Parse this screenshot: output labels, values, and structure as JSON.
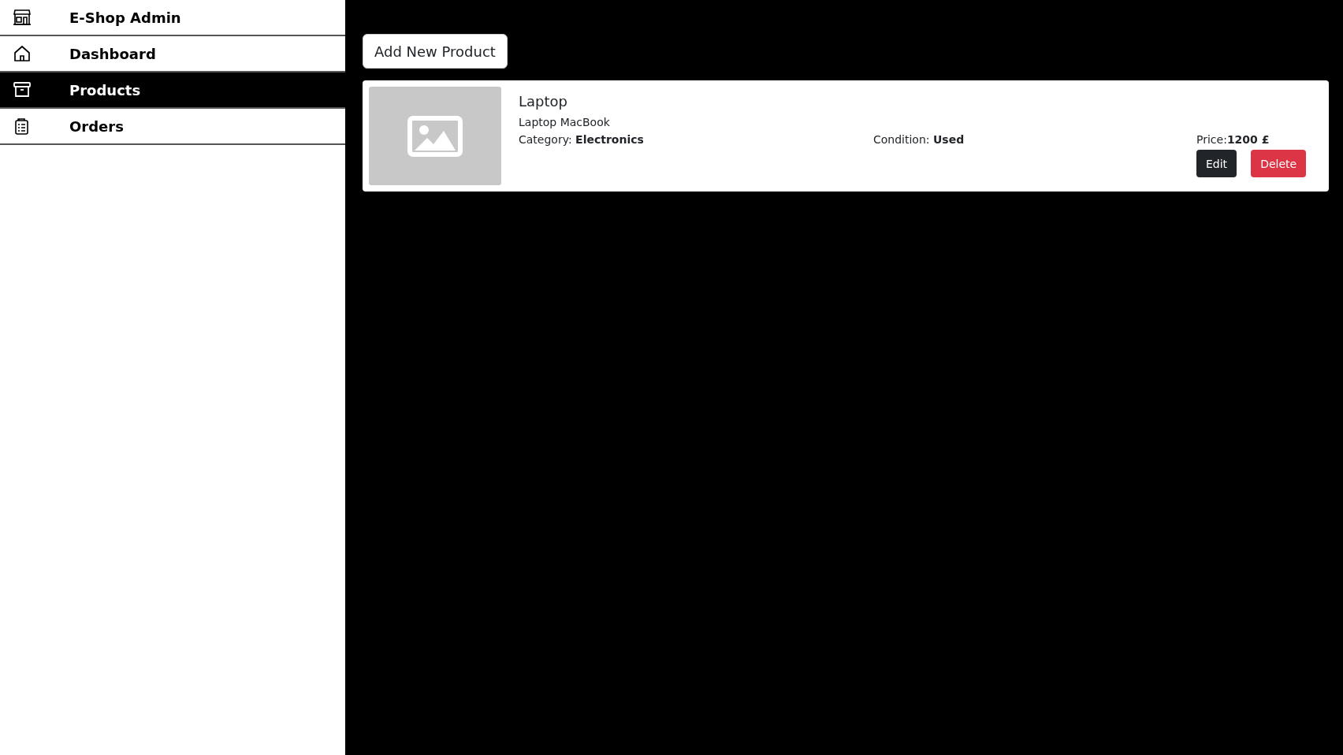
{
  "sidebar": {
    "brand": {
      "title": "E-Shop Admin"
    },
    "items": [
      {
        "label": "Dashboard",
        "kind": "home",
        "selected": false
      },
      {
        "label": "Products",
        "kind": "box",
        "selected": true
      },
      {
        "label": "Orders",
        "kind": "clipboard",
        "selected": false
      }
    ]
  },
  "main": {
    "add_button": "Add New Product",
    "products": [
      {
        "name": "Laptop",
        "description": "Laptop MacBook",
        "category": "Category: **Electronics**",
        "condition": "Condition: **Used**",
        "price": "Price:**1200 £**",
        "buttons": [
          "Edit",
          "Delete"
        ]
      }
    ]
  }
}
